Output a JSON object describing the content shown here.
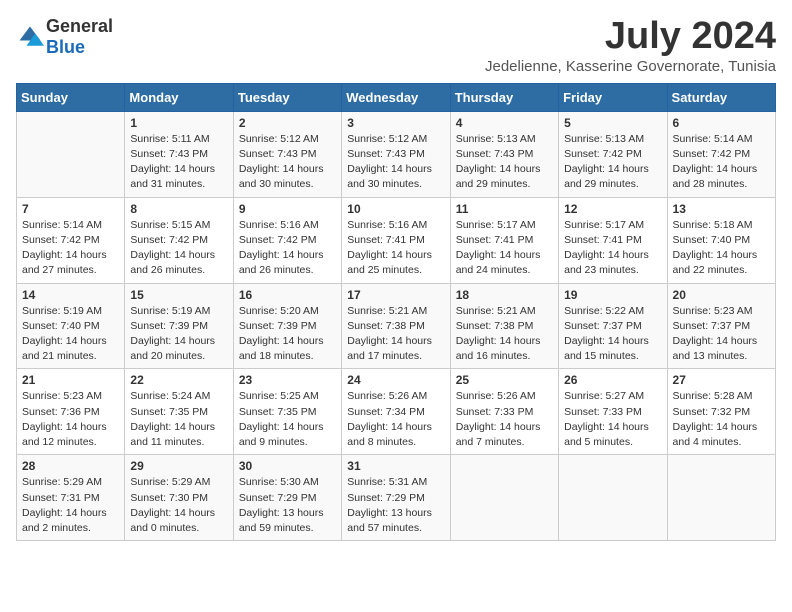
{
  "logo": {
    "general": "General",
    "blue": "Blue"
  },
  "title": "July 2024",
  "location": "Jedelienne, Kasserine Governorate, Tunisia",
  "days_header": [
    "Sunday",
    "Monday",
    "Tuesday",
    "Wednesday",
    "Thursday",
    "Friday",
    "Saturday"
  ],
  "weeks": [
    [
      {
        "day": "",
        "info": ""
      },
      {
        "day": "1",
        "info": "Sunrise: 5:11 AM\nSunset: 7:43 PM\nDaylight: 14 hours\nand 31 minutes."
      },
      {
        "day": "2",
        "info": "Sunrise: 5:12 AM\nSunset: 7:43 PM\nDaylight: 14 hours\nand 30 minutes."
      },
      {
        "day": "3",
        "info": "Sunrise: 5:12 AM\nSunset: 7:43 PM\nDaylight: 14 hours\nand 30 minutes."
      },
      {
        "day": "4",
        "info": "Sunrise: 5:13 AM\nSunset: 7:43 PM\nDaylight: 14 hours\nand 29 minutes."
      },
      {
        "day": "5",
        "info": "Sunrise: 5:13 AM\nSunset: 7:42 PM\nDaylight: 14 hours\nand 29 minutes."
      },
      {
        "day": "6",
        "info": "Sunrise: 5:14 AM\nSunset: 7:42 PM\nDaylight: 14 hours\nand 28 minutes."
      }
    ],
    [
      {
        "day": "7",
        "info": "Sunrise: 5:14 AM\nSunset: 7:42 PM\nDaylight: 14 hours\nand 27 minutes."
      },
      {
        "day": "8",
        "info": "Sunrise: 5:15 AM\nSunset: 7:42 PM\nDaylight: 14 hours\nand 26 minutes."
      },
      {
        "day": "9",
        "info": "Sunrise: 5:16 AM\nSunset: 7:42 PM\nDaylight: 14 hours\nand 26 minutes."
      },
      {
        "day": "10",
        "info": "Sunrise: 5:16 AM\nSunset: 7:41 PM\nDaylight: 14 hours\nand 25 minutes."
      },
      {
        "day": "11",
        "info": "Sunrise: 5:17 AM\nSunset: 7:41 PM\nDaylight: 14 hours\nand 24 minutes."
      },
      {
        "day": "12",
        "info": "Sunrise: 5:17 AM\nSunset: 7:41 PM\nDaylight: 14 hours\nand 23 minutes."
      },
      {
        "day": "13",
        "info": "Sunrise: 5:18 AM\nSunset: 7:40 PM\nDaylight: 14 hours\nand 22 minutes."
      }
    ],
    [
      {
        "day": "14",
        "info": "Sunrise: 5:19 AM\nSunset: 7:40 PM\nDaylight: 14 hours\nand 21 minutes."
      },
      {
        "day": "15",
        "info": "Sunrise: 5:19 AM\nSunset: 7:39 PM\nDaylight: 14 hours\nand 20 minutes."
      },
      {
        "day": "16",
        "info": "Sunrise: 5:20 AM\nSunset: 7:39 PM\nDaylight: 14 hours\nand 18 minutes."
      },
      {
        "day": "17",
        "info": "Sunrise: 5:21 AM\nSunset: 7:38 PM\nDaylight: 14 hours\nand 17 minutes."
      },
      {
        "day": "18",
        "info": "Sunrise: 5:21 AM\nSunset: 7:38 PM\nDaylight: 14 hours\nand 16 minutes."
      },
      {
        "day": "19",
        "info": "Sunrise: 5:22 AM\nSunset: 7:37 PM\nDaylight: 14 hours\nand 15 minutes."
      },
      {
        "day": "20",
        "info": "Sunrise: 5:23 AM\nSunset: 7:37 PM\nDaylight: 14 hours\nand 13 minutes."
      }
    ],
    [
      {
        "day": "21",
        "info": "Sunrise: 5:23 AM\nSunset: 7:36 PM\nDaylight: 14 hours\nand 12 minutes."
      },
      {
        "day": "22",
        "info": "Sunrise: 5:24 AM\nSunset: 7:35 PM\nDaylight: 14 hours\nand 11 minutes."
      },
      {
        "day": "23",
        "info": "Sunrise: 5:25 AM\nSunset: 7:35 PM\nDaylight: 14 hours\nand 9 minutes."
      },
      {
        "day": "24",
        "info": "Sunrise: 5:26 AM\nSunset: 7:34 PM\nDaylight: 14 hours\nand 8 minutes."
      },
      {
        "day": "25",
        "info": "Sunrise: 5:26 AM\nSunset: 7:33 PM\nDaylight: 14 hours\nand 7 minutes."
      },
      {
        "day": "26",
        "info": "Sunrise: 5:27 AM\nSunset: 7:33 PM\nDaylight: 14 hours\nand 5 minutes."
      },
      {
        "day": "27",
        "info": "Sunrise: 5:28 AM\nSunset: 7:32 PM\nDaylight: 14 hours\nand 4 minutes."
      }
    ],
    [
      {
        "day": "28",
        "info": "Sunrise: 5:29 AM\nSunset: 7:31 PM\nDaylight: 14 hours\nand 2 minutes."
      },
      {
        "day": "29",
        "info": "Sunrise: 5:29 AM\nSunset: 7:30 PM\nDaylight: 14 hours\nand 0 minutes."
      },
      {
        "day": "30",
        "info": "Sunrise: 5:30 AM\nSunset: 7:29 PM\nDaylight: 13 hours\nand 59 minutes."
      },
      {
        "day": "31",
        "info": "Sunrise: 5:31 AM\nSunset: 7:29 PM\nDaylight: 13 hours\nand 57 minutes."
      },
      {
        "day": "",
        "info": ""
      },
      {
        "day": "",
        "info": ""
      },
      {
        "day": "",
        "info": ""
      }
    ]
  ]
}
